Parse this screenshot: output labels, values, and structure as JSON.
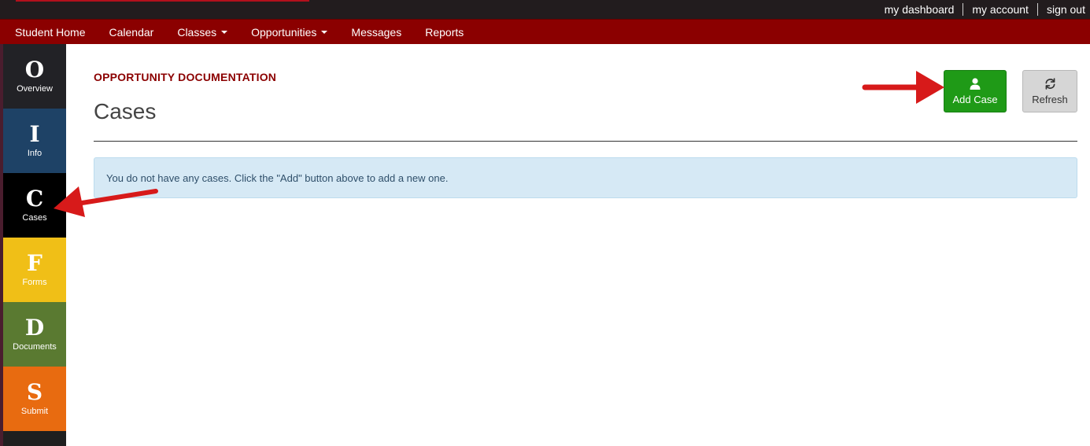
{
  "top_links": [
    "my dashboard",
    "my account",
    "sign out"
  ],
  "nav": {
    "items": [
      {
        "label": "Student Home",
        "dropdown": false
      },
      {
        "label": "Calendar",
        "dropdown": false
      },
      {
        "label": "Classes",
        "dropdown": true
      },
      {
        "label": "Opportunities",
        "dropdown": true
      },
      {
        "label": "Messages",
        "dropdown": false
      },
      {
        "label": "Reports",
        "dropdown": false
      }
    ]
  },
  "sidebar": {
    "tabs": [
      {
        "letter": "O",
        "label": "Overview",
        "color": "#222226"
      },
      {
        "letter": "I",
        "label": "Info",
        "color": "#1e4266"
      },
      {
        "letter": "C",
        "label": "Cases",
        "color": "#000000",
        "active": true
      },
      {
        "letter": "F",
        "label": "Forms",
        "color": "#f0bf17"
      },
      {
        "letter": "D",
        "label": "Documents",
        "color": "#5a7a31"
      },
      {
        "letter": "S",
        "label": "Submit",
        "color": "#e86b10"
      }
    ]
  },
  "main": {
    "eyebrow": "OPPORTUNITY DOCUMENTATION",
    "title": "Cases",
    "alert": "You do not have any cases. Click the \"Add\" button above to add a new one."
  },
  "toolbar": {
    "add_label": "Add Case",
    "add_icon": "user-icon",
    "refresh_label": "Refresh",
    "refresh_icon": "refresh-icon"
  },
  "colors": {
    "nav_bg": "#8b0000",
    "add_button": "#1f9a17",
    "annotation_arrow": "#d71a1a"
  }
}
